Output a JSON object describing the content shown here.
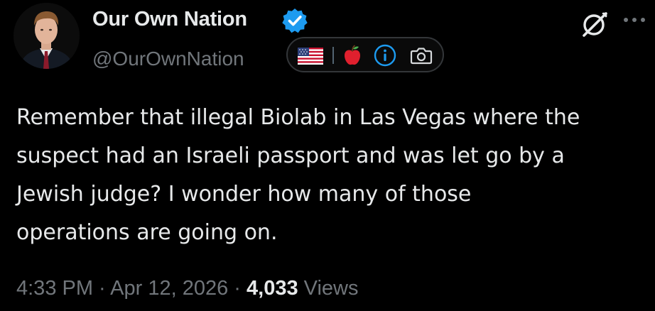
{
  "author": {
    "display_name": "Our Own Nation",
    "handle": "@OurOwnNation"
  },
  "badges": [
    "us-flag-icon",
    "apple-icon",
    "info-icon",
    "camera-icon"
  ],
  "tweet": {
    "text": "Remember that illegal Biolab in Las Vegas where the\nsuspect had an Israeli passport and was let go by a\nJewish judge? I wonder how many of those\noperations are going on."
  },
  "meta": {
    "time": "4:33 PM",
    "separator": " · ",
    "date": "Apr 12, 2026",
    "views_count": "4,033",
    "views_label": " Views"
  },
  "colors": {
    "background": "#000000",
    "text": "#e7e9ea",
    "secondary": "#71767b",
    "verified": "#1d9bf0"
  }
}
